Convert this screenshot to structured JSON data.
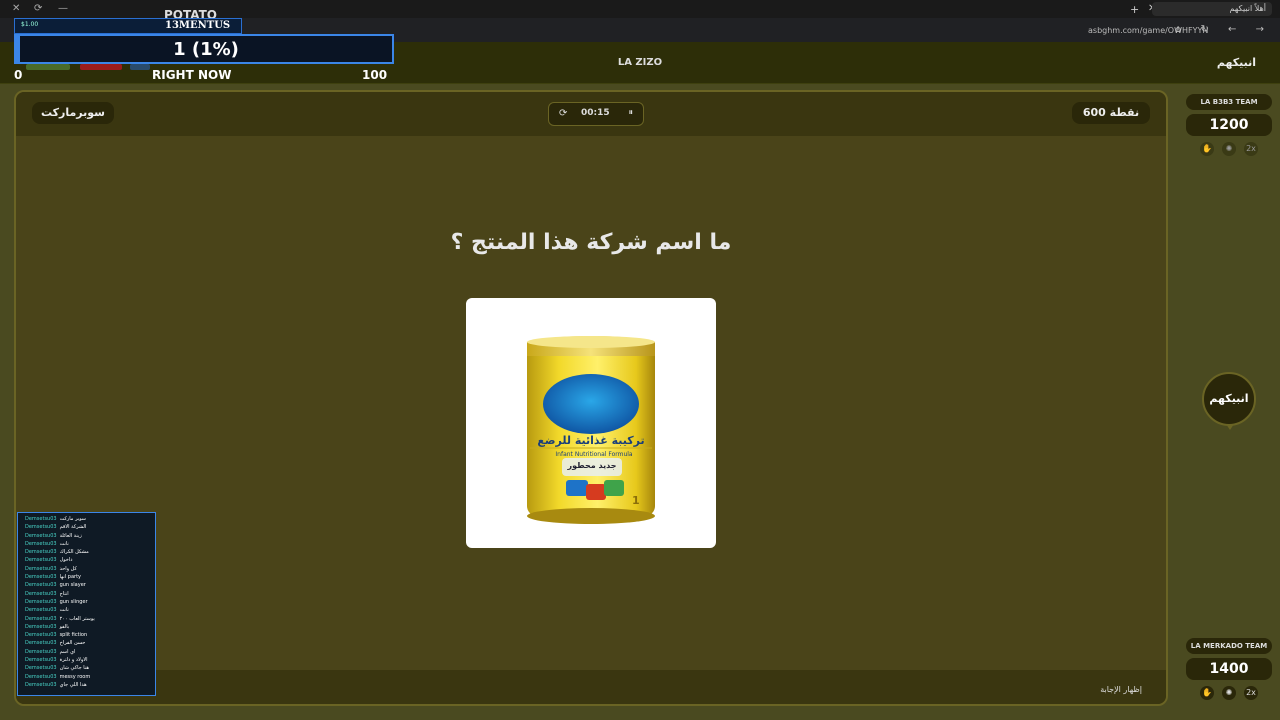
{
  "browser": {
    "tab_title": "أهلاً انبيكهم",
    "url": "asbghm.com/game/OWHFYYN",
    "nav_icons": "⌂ ↻ ← →",
    "window_controls": [
      "✕",
      "⟳",
      "—"
    ],
    "new_tab": "+",
    "close_tab": "✕"
  },
  "stream_overlay": {
    "money": "$1.00",
    "name": "13MENTUS",
    "behind_text": "POTATO",
    "progress_text": "1 (1%)",
    "progress_fraction": 0.01,
    "min_label": "0",
    "center_label": "RIGHT NOW",
    "max_label": "100",
    "chip_colors": [
      "#4a6b2a",
      "#9b1c1c",
      "#2a4b6b"
    ]
  },
  "header": {
    "center_title": "LA ZIZO",
    "right_title": "انبيكهم"
  },
  "game": {
    "category": "سوبرماركت",
    "points": "600 نقطة",
    "timer": {
      "reset_icon": "⟳",
      "time": "00:15",
      "pause_icon": "⏸"
    },
    "question": "ما اسم شركة هذا المنتج ؟",
    "product": {
      "arabic_title": "تركيبة غذائية للرضع",
      "english_title": "Infant Nutritional Formula",
      "badge": "جديد محطور",
      "stage": "1"
    },
    "show_answer": "إظهار الإجابة"
  },
  "teams": [
    {
      "name": "LA B3B3 TEAM",
      "score": "1200",
      "tools": [
        "✋",
        "✺",
        "2x"
      ]
    },
    {
      "name": "LA MERKADO TEAM",
      "score": "1400",
      "tools": [
        "✋",
        "✺",
        "2x"
      ]
    }
  ],
  "turn_badge": "انبيكهم",
  "chat": [
    {
      "user": "Demsetsu03",
      "msg": "سوبر ماركت"
    },
    {
      "user": "Demsetsu03",
      "msg": "الشركة الاقم"
    },
    {
      "user": "Demsetsu03",
      "msg": "زينة العائلة"
    },
    {
      "user": "Demsetsu03",
      "msg": "نانت"
    },
    {
      "user": "Demsetsu03",
      "msg": "مشكل الكراك"
    },
    {
      "user": "Demsetsu03",
      "msg": "داخول"
    },
    {
      "user": "Demsetsu03",
      "msg": "كل واحد"
    },
    {
      "user": "Demsetsu03",
      "msg": "انها party"
    },
    {
      "user": "Demsetsu03",
      "msg": "gun slayer"
    },
    {
      "user": "Demsetsu03",
      "msg": "انتاج"
    },
    {
      "user": "Demsetsu03",
      "msg": "gun slinger"
    },
    {
      "user": "Demsetsu03",
      "msg": "نانت"
    },
    {
      "user": "Demsetsu03",
      "msg": "يوستر العاب ٢٠٠"
    },
    {
      "user": "Demsetsu03",
      "msg": "بالفو"
    },
    {
      "user": "Demsetsu03",
      "msg": "split fiction"
    },
    {
      "user": "Demsetsu03",
      "msg": "حسن الفراخ"
    },
    {
      "user": "Demsetsu03",
      "msg": "اي اسم"
    },
    {
      "user": "Demsetsu03",
      "msg": "الاولاد و دلترة"
    },
    {
      "user": "Demsetsu03",
      "msg": "هنا جاكي شان"
    },
    {
      "user": "Demsetsu03",
      "msg": "messy room"
    },
    {
      "user": "Demsetsu03",
      "msg": "هذا اللي جاي"
    }
  ]
}
